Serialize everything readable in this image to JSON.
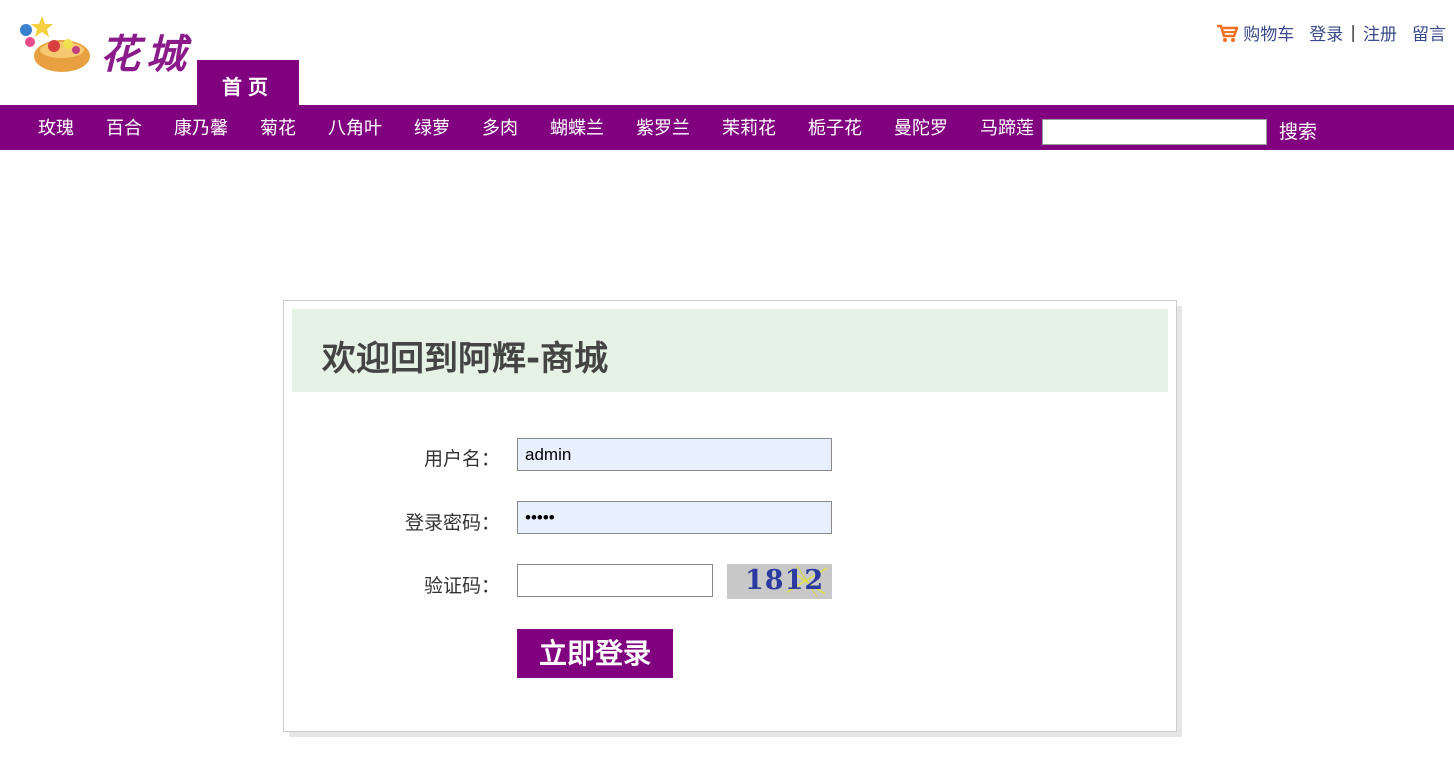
{
  "header": {
    "logo_text": "花城",
    "home_tab": "首页",
    "top_links": {
      "cart": "购物车",
      "login": "登录",
      "separator": "|",
      "register": "注册",
      "message": "留言"
    }
  },
  "nav": {
    "items": [
      "玫瑰",
      "百合",
      "康乃馨",
      "菊花",
      "八角叶",
      "绿萝",
      "多肉",
      "蝴蝶兰",
      "紫罗兰",
      "茉莉花",
      "栀子花",
      "曼陀罗",
      "马蹄莲"
    ],
    "search_value": "",
    "search_button": "搜索"
  },
  "login": {
    "title": "欢迎回到阿辉-商城",
    "username_label": "用户名：",
    "username_value": "admin",
    "password_label": "登录密码：",
    "password_value": "•••••",
    "captcha_label": "验证码：",
    "captcha_value": "",
    "captcha_image_text": "1812",
    "submit": "立即登录"
  },
  "colors": {
    "brand_purple": "#800080",
    "header_green": "#e6f2e6",
    "link_blue": "#3a4a8a",
    "cart_orange": "#f07020"
  }
}
